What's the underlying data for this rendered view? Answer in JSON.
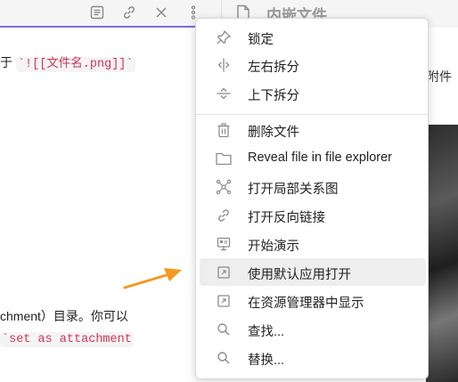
{
  "editor": {
    "line1_prefix": "于 ",
    "line1_code": "`![[文件名.png]]`",
    "line2_text": "chment）目录。你可以",
    "line3_code": "`set as attachment "
  },
  "right_pane": {
    "title": "内嵌文件",
    "snippet": "附件"
  },
  "toolbar": {
    "icons": [
      "reading-view-icon",
      "link-icon",
      "close-icon",
      "more-options-icon"
    ]
  },
  "menu": {
    "items": [
      {
        "label": "锁定",
        "icon": "pin-icon"
      },
      {
        "label": "左右拆分",
        "icon": "split-vertical-icon"
      },
      {
        "label": "上下拆分",
        "icon": "split-horizontal-icon"
      },
      {
        "label": "删除文件",
        "icon": "trash-icon"
      },
      {
        "label": "Reveal file in file explorer",
        "icon": "folder-icon"
      },
      {
        "label": "打开局部关系图",
        "icon": "graph-icon"
      },
      {
        "label": "打开反向链接",
        "icon": "link-icon"
      },
      {
        "label": "开始演示",
        "icon": "presentation-icon"
      },
      {
        "label": "使用默认应用打开",
        "icon": "open-external-icon"
      },
      {
        "label": "在资源管理器中显示",
        "icon": "open-external-icon"
      },
      {
        "label": "查找...",
        "icon": "search-icon"
      },
      {
        "label": "替换...",
        "icon": "search-icon"
      }
    ],
    "highlighted_item": "使用默认应用打开"
  },
  "colors": {
    "accent": "#7d6dd8",
    "code_text": "#d2355a",
    "arrow": "#f39a1e",
    "highlight": "#eeeeef"
  }
}
